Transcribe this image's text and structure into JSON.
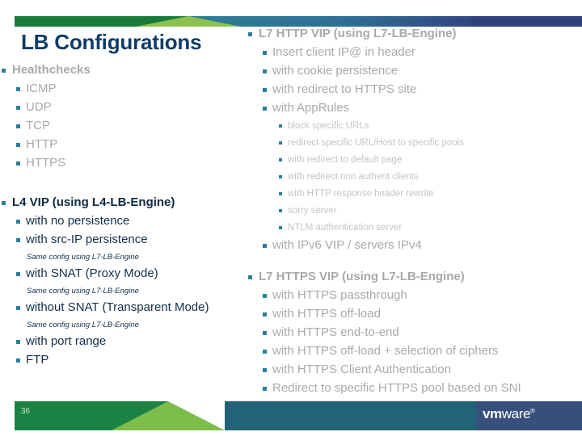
{
  "slide": {
    "title": "LB Configurations",
    "page_number": "36",
    "logo": {
      "bold_part": "vm",
      "light_part": "ware",
      "registered_mark": "®"
    }
  },
  "colors": {
    "title": "#0f3c68",
    "bullet": "#2b7e9c",
    "gray_text": "#a7a9ac",
    "navy_text": "#0d2b45",
    "bar_green": "#1a7a3c",
    "bar_light_green": "#8cc152",
    "bar_teal": "#2e7f96",
    "bar_navy": "#2e4279",
    "footer_green": "#1a8242",
    "footer_light_green": "#7cbd4c",
    "footer_teal": "#216377",
    "footer_navy": "#374f7c"
  },
  "left_column": {
    "healthchecks": {
      "heading": "Healthchecks",
      "items": [
        "ICMP",
        "UDP",
        "TCP",
        "HTTP",
        "HTTPS"
      ]
    },
    "l4_vip": {
      "heading": "L4 VIP (using L4-LB-Engine)",
      "items": [
        {
          "label": "with no persistence",
          "note": null
        },
        {
          "label": "with src-IP persistence",
          "note": "Same config using L7-LB-Engine"
        },
        {
          "label": "with SNAT (Proxy Mode)",
          "note": "Same config using L7-LB-Engine"
        },
        {
          "label": "without SNAT (Transparent Mode)",
          "note": "Same config using L7-LB-Engine"
        },
        {
          "label": "with port range",
          "note": null
        },
        {
          "label": "FTP",
          "note": null
        }
      ]
    }
  },
  "right_column": {
    "l7_http_vip": {
      "heading": "L7 HTTP VIP (using L7-LB-Engine)",
      "items": [
        "Insert client IP@ in header",
        "with cookie persistence",
        "with redirect to HTTPS site",
        "with AppRules"
      ],
      "apprules_subitems": [
        "block specific URLs",
        "redirect specific URL/Host to specific pools",
        "with redirect to default page",
        "with redirect non authent clients",
        "with HTTP response header rewrite",
        "sorry server",
        "NTLM authentication server"
      ],
      "trailing_item": "with IPv6 VIP / servers IPv4"
    },
    "l7_https_vip": {
      "heading": "L7 HTTPS VIP (using L7-LB-Engine)",
      "items": [
        "with HTTPS passthrough",
        "with HTTPS off-load",
        "with HTTPS end-to-end",
        "with HTTPS off-load + selection of ciphers",
        "with HTTPS Client Authentication",
        "Redirect to specific HTTPS pool based on SNI"
      ]
    }
  }
}
